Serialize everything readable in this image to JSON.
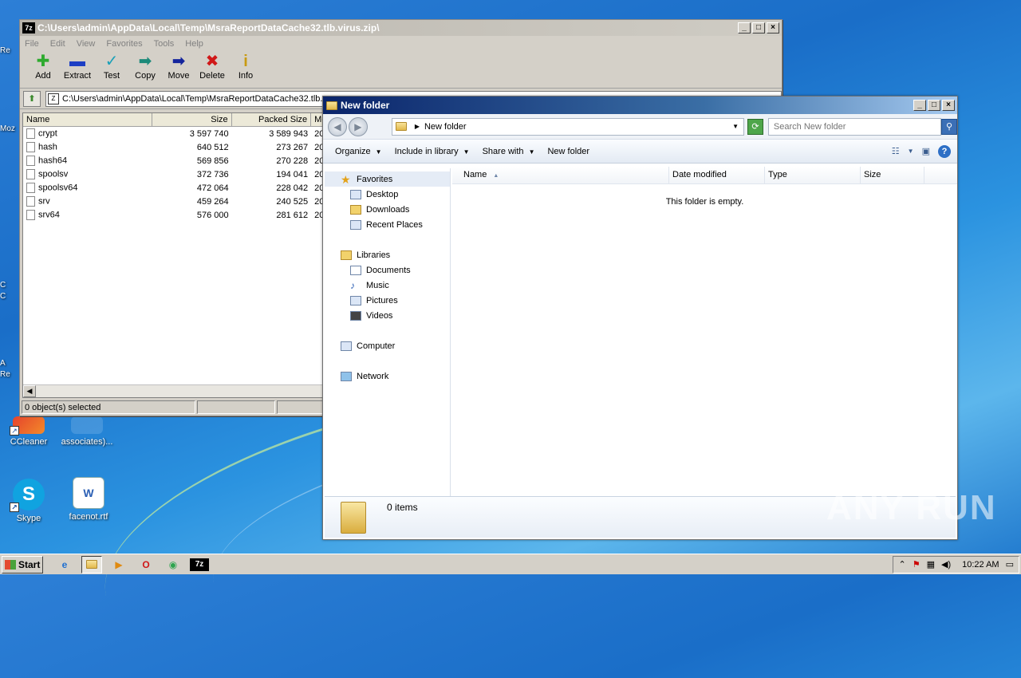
{
  "desktop": {
    "icons": [
      {
        "label": "CCleaner"
      },
      {
        "label": "associates)..."
      },
      {
        "label": "Skype"
      },
      {
        "label": "facenot.rtf"
      }
    ],
    "partial_labels": [
      "Re",
      "Moz",
      "C",
      "C",
      "A",
      "Re"
    ],
    "watermark": "ANY RUN"
  },
  "zip": {
    "title": "C:\\Users\\admin\\AppData\\Local\\Temp\\MsraReportDataCache32.tlb.virus.zip\\",
    "app_icon": "7z",
    "menu": [
      "File",
      "Edit",
      "View",
      "Favorites",
      "Tools",
      "Help"
    ],
    "toolbar": [
      {
        "label": "Add",
        "glyph": "✚",
        "color": "#2eaa2e"
      },
      {
        "label": "Extract",
        "glyph": "▬",
        "color": "#1d3fc4"
      },
      {
        "label": "Test",
        "glyph": "✓",
        "color": "#1aa0b8"
      },
      {
        "label": "Copy",
        "glyph": "➡",
        "color": "#1c8a7a"
      },
      {
        "label": "Move",
        "glyph": "➡",
        "color": "#14249c"
      },
      {
        "label": "Delete",
        "glyph": "✖",
        "color": "#d01818"
      },
      {
        "label": "Info",
        "glyph": "i",
        "color": "#c89a10"
      }
    ],
    "address": "C:\\Users\\admin\\AppData\\Local\\Temp\\MsraReportDataCache32.tlb.",
    "columns": {
      "name": "Name",
      "size": "Size",
      "packed": "Packed Size",
      "modified": "Mo"
    },
    "files": [
      {
        "name": "crypt",
        "size": "3 597 740",
        "packed": "3 589 943",
        "mod": "20"
      },
      {
        "name": "hash",
        "size": "640 512",
        "packed": "273 267",
        "mod": "20"
      },
      {
        "name": "hash64",
        "size": "569 856",
        "packed": "270 228",
        "mod": "20"
      },
      {
        "name": "spoolsv",
        "size": "372 736",
        "packed": "194 041",
        "mod": "20"
      },
      {
        "name": "spoolsv64",
        "size": "472 064",
        "packed": "228 042",
        "mod": "20"
      },
      {
        "name": "srv",
        "size": "459 264",
        "packed": "240 525",
        "mod": "20"
      },
      {
        "name": "srv64",
        "size": "576 000",
        "packed": "281 612",
        "mod": "20"
      }
    ],
    "status": "0 object(s) selected"
  },
  "explorer": {
    "title": "New folder",
    "breadcrumb": "New folder",
    "search_placeholder": "Search New folder",
    "commands": {
      "organize": "Organize",
      "include": "Include in library",
      "share": "Share with",
      "newfolder": "New folder"
    },
    "nav": {
      "favorites": "Favorites",
      "desktop": "Desktop",
      "downloads": "Downloads",
      "recent": "Recent Places",
      "libraries": "Libraries",
      "documents": "Documents",
      "music": "Music",
      "pictures": "Pictures",
      "videos": "Videos",
      "computer": "Computer",
      "network": "Network"
    },
    "columns": {
      "name": "Name",
      "date": "Date modified",
      "type": "Type",
      "size": "Size"
    },
    "empty_text": "This folder is empty.",
    "items_count": "0 items"
  },
  "taskbar": {
    "start": "Start",
    "zip_button": "7z",
    "clock": "10:22 AM"
  }
}
